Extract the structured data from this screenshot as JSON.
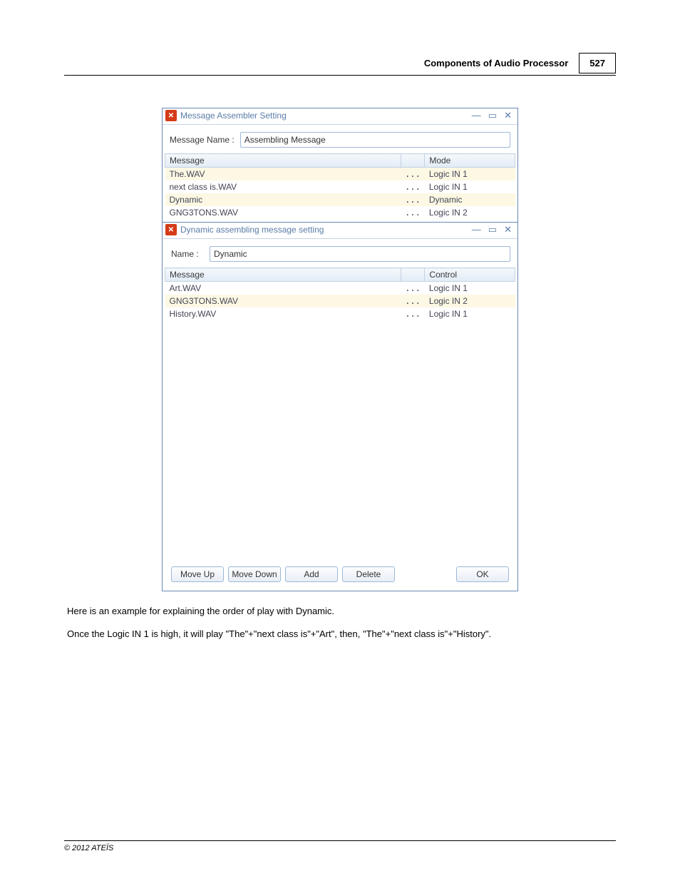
{
  "header": {
    "title": "Components of Audio Processor",
    "page_number": "527"
  },
  "window1": {
    "title": "Message Assembler Setting",
    "name_label": "Message Name :",
    "name_value": "Assembling Message",
    "col_message": "Message",
    "col_mode": "Mode",
    "rows": [
      {
        "msg": "The.WAV",
        "ell": "...",
        "mode": "Logic IN 1"
      },
      {
        "msg": "next class is.WAV",
        "ell": "...",
        "mode": "Logic IN 1"
      },
      {
        "msg": "Dynamic",
        "ell": "...",
        "mode": "Dynamic"
      },
      {
        "msg": "GNG3TONS.WAV",
        "ell": "...",
        "mode": "Logic IN 2"
      }
    ]
  },
  "window2": {
    "title": "Dynamic assembling message setting",
    "name_label": "Name :",
    "name_value": "Dynamic",
    "col_message": "Message",
    "col_control": "Control",
    "rows": [
      {
        "msg": "Art.WAV",
        "ell": "...",
        "mode": "Logic IN 1"
      },
      {
        "msg": "GNG3TONS.WAV",
        "ell": "...",
        "mode": "Logic IN 2"
      },
      {
        "msg": "History.WAV",
        "ell": "...",
        "mode": "Logic IN 1"
      }
    ],
    "buttons": {
      "move_up": "Move Up",
      "move_down": "Move Down",
      "add": "Add",
      "delete": "Delete",
      "ok": "OK"
    }
  },
  "body": {
    "p1": "Here is an example for explaining the order of play with Dynamic.",
    "p2": "Once the Logic IN 1 is high, it will play \"The\"+\"next class is\"+\"Art\", then, \"The\"+\"next class is\"+\"History\"."
  },
  "footer": "© 2012 ATEÏS"
}
